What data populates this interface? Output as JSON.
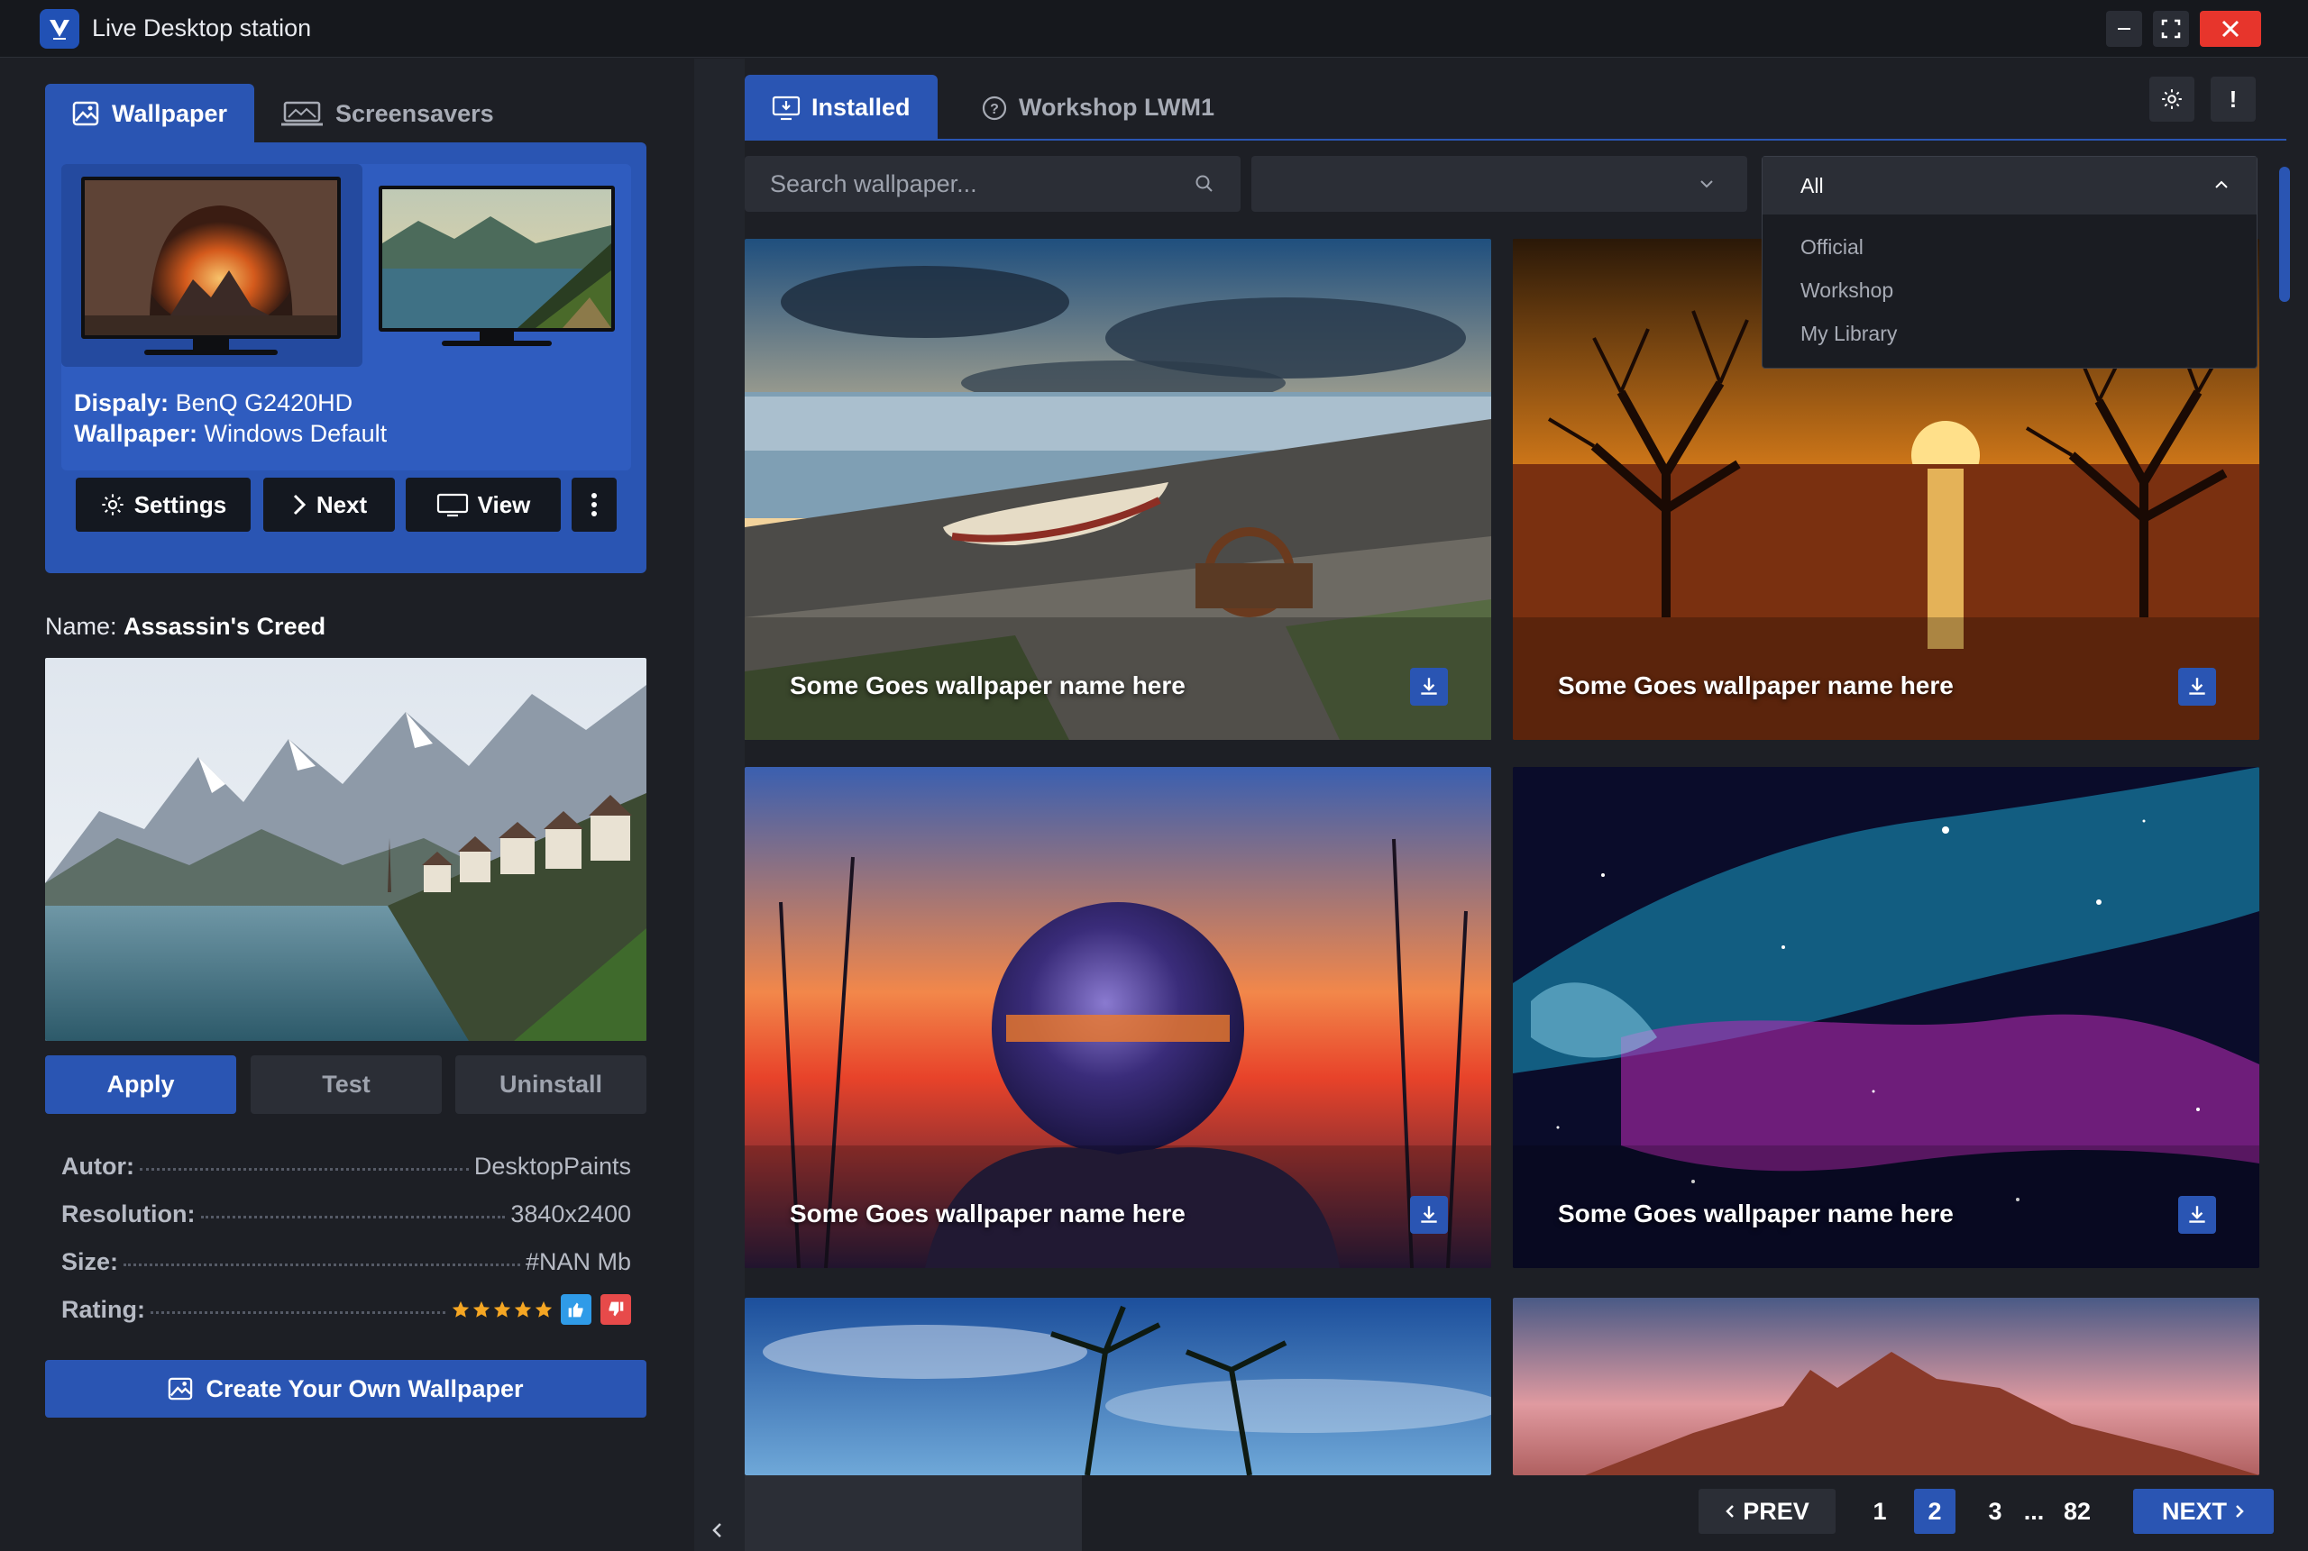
{
  "window": {
    "title": "Live Desktop station"
  },
  "left": {
    "tabs": [
      {
        "label": "Wallpaper",
        "active": true
      },
      {
        "label": "Screensavers",
        "active": false
      }
    ],
    "display_label": "Dispaly:",
    "display_value": "BenQ G2420HD",
    "wallpaper_label": "Wallpaper:",
    "wallpaper_value": "Windows Default",
    "monitor_buttons": {
      "settings": "Settings",
      "next": "Next",
      "view": "View"
    },
    "name_label": "Name:",
    "name_value": "Assassin's Creed",
    "actions": {
      "apply": "Apply",
      "test": "Test",
      "uninstall": "Uninstall"
    },
    "meta": [
      {
        "label": "Autor:",
        "value": "DesktopPaints"
      },
      {
        "label": "Resolution:",
        "value": "3840x2400"
      },
      {
        "label": "Size:",
        "value": "#NAN Mb"
      },
      {
        "label": "Rating:",
        "value": ""
      }
    ],
    "rating_stars": 5,
    "create_button": "Create Your Own Wallpaper"
  },
  "right": {
    "tabs": [
      {
        "label": "Installed",
        "active": true
      },
      {
        "label": "Workshop LWM1",
        "active": false
      }
    ],
    "alert_button": "!",
    "search": {
      "placeholder": "Search wallpaper..."
    },
    "filter": {
      "selected": "All",
      "options": [
        "Official",
        "Workshop",
        "My Library"
      ]
    },
    "cards": [
      {
        "title": "Some Goes wallpaper name here"
      },
      {
        "title": "Some Goes wallpaper name here"
      },
      {
        "title": "Some Goes wallpaper name here"
      },
      {
        "title": "Some Goes wallpaper name here"
      }
    ],
    "pagination": {
      "prev": "PREV",
      "next": "NEXT",
      "pages": [
        "1",
        "2",
        "3",
        "...",
        "82"
      ],
      "current": "2"
    }
  },
  "colors": {
    "accent": "#2a55b3",
    "background": "#1d1f25",
    "close": "#e7352c",
    "star": "#f5a623",
    "thumb_up": "#2f9be8",
    "thumb_down": "#e74a4a"
  }
}
